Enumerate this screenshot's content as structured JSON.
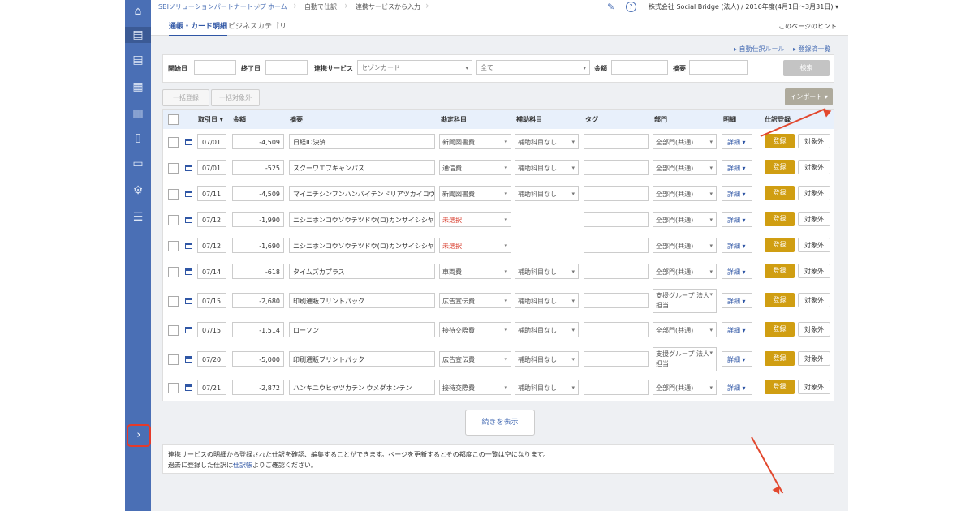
{
  "sidebar": {
    "icons": [
      "home-icon",
      "journal-add-icon",
      "report-icon",
      "ledger-icon",
      "chart-icon",
      "document-icon",
      "print-icon",
      "settings-icon",
      "list-icon"
    ],
    "expand_glyph": "›"
  },
  "breadcrumb": [
    "SBIソリューションパートナートップ",
    "ホーム",
    "自動で仕訳",
    "連携サービスから入力"
  ],
  "header": {
    "company": "株式会社 Social Bridge (法人) / 2016年度(4月1日〜3月31日)",
    "hint_link": "このページのヒント"
  },
  "tabs": [
    {
      "label": "通帳・カード明細",
      "active": true
    },
    {
      "label": "ビジネスカテゴリ",
      "active": false
    }
  ],
  "links": {
    "auto_rule": "▸ 自動仕訳ルール",
    "registered_list": "▸ 登録済一覧"
  },
  "filter": {
    "start_label": "開始日",
    "end_label": "終了日",
    "service_label": "連携サービス",
    "service_value": "セゾンカード",
    "type_value": "全て",
    "amount_label": "金額",
    "memo_label": "摘要",
    "search_button": "検索"
  },
  "actions": {
    "bulk_register": "一括登録",
    "bulk_exclude": "一括対象外",
    "import": "インポート ▾"
  },
  "table": {
    "headers": [
      "取引日 ▾",
      "金額",
      "摘要",
      "勘定科目",
      "補助科目",
      "タグ",
      "部門",
      "明細",
      "仕訳登録"
    ],
    "detail_label": "詳細 ▾",
    "register_label": "登録",
    "exclude_label": "対象外",
    "rows": [
      {
        "date": "07/01",
        "amount": "-4,509",
        "memo": "日経ID決済",
        "account": "新聞図書費",
        "account_red": false,
        "sub": "補助科目なし",
        "dept": "全部門(共通)"
      },
      {
        "date": "07/01",
        "amount": "-525",
        "memo": "スクーワエブキャンパス",
        "account": "通信費",
        "account_red": false,
        "sub": "補助科目なし",
        "dept": "全部門(共通)"
      },
      {
        "date": "07/11",
        "amount": "-4,509",
        "memo": "マイニチシンブンハンバイテンドリアツカイコウト",
        "account": "新聞図書費",
        "account_red": false,
        "sub": "補助科目なし",
        "dept": "全部門(共通)"
      },
      {
        "date": "07/12",
        "amount": "-1,990",
        "memo": "ニシニホンコウソウテツドウ(ロ)カンサイシシヤ",
        "account": "未選択",
        "account_red": true,
        "sub": "",
        "dept": "全部門(共通)"
      },
      {
        "date": "07/12",
        "amount": "-1,690",
        "memo": "ニシニホンコウソウテツドウ(ロ)カンサイシシヤ",
        "account": "未選択",
        "account_red": true,
        "sub": "",
        "dept": "全部門(共通)"
      },
      {
        "date": "07/14",
        "amount": "-618",
        "memo": "タイムズカプラス",
        "account": "車両費",
        "account_red": false,
        "sub": "補助科目なし",
        "dept": "全部門(共通)"
      },
      {
        "date": "07/15",
        "amount": "-2,680",
        "memo": "印刷通販プリントパック",
        "account": "広告宣伝費",
        "account_red": false,
        "sub": "補助科目なし",
        "dept": "支援グループ 法人担当"
      },
      {
        "date": "07/15",
        "amount": "-1,514",
        "memo": "ローソン",
        "account": "接待交際費",
        "account_red": false,
        "sub": "補助科目なし",
        "dept": "全部門(共通)"
      },
      {
        "date": "07/20",
        "amount": "-5,000",
        "memo": "印刷通販プリントパック",
        "account": "広告宣伝費",
        "account_red": false,
        "sub": "補助科目なし",
        "dept": "支援グループ 法人担当"
      },
      {
        "date": "07/21",
        "amount": "-2,872",
        "memo": "ハンキユウヒヤツカテン ウメダホンテン",
        "account": "接待交際費",
        "account_red": false,
        "sub": "補助科目なし",
        "dept": "全部門(共通)"
      }
    ],
    "more_button": "続きを表示"
  },
  "notes": {
    "line1": "連携サービスの明細から登録された仕訳を確認、編集することができます。ページを更新するとその都度この一覧は空になります。",
    "line2_pre": "過去に登録した仕訳は",
    "line2_link": "仕訳帳",
    "line2_post": "よりご確認ください。"
  },
  "colors": {
    "sidebar": "#4a6fb5",
    "register_button": "#d09e12",
    "annotation_arrow": "#e2482e",
    "unselected_account": "#d83b2b"
  }
}
